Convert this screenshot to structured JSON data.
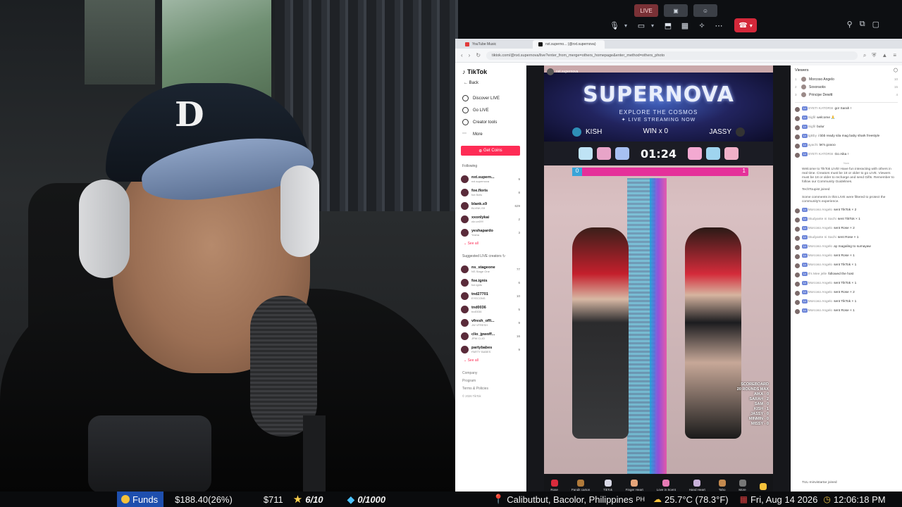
{
  "meeting": {
    "avatars": [
      "LIVE",
      "",
      ""
    ],
    "hangup_icon": "phone-hangup-icon"
  },
  "browser": {
    "tabs": [
      {
        "label": "YouTube Music",
        "icon": "youtube-music-icon"
      },
      {
        "label": "nxt.superno... (@nxt.supernova)",
        "icon": "tiktok-icon"
      }
    ],
    "url": "tiktok.com/@nxt.supernova/live?enter_from_merge=others_homepage&enter_method=others_photo"
  },
  "sidebar": {
    "logo": "TikTok",
    "back": "Back",
    "nav": [
      {
        "label": "Discover LIVE",
        "icon": "discover-icon"
      },
      {
        "label": "Go LIVE",
        "icon": "golive-icon"
      },
      {
        "label": "Creator tools",
        "icon": "tools-icon"
      },
      {
        "label": "More",
        "icon": "more-icon"
      }
    ],
    "get_coins": "Get Coins",
    "following_title": "Following",
    "following": [
      {
        "name": "nxt.supern...",
        "sub": "nxt.supernova",
        "count": "9"
      },
      {
        "name": "foe.floris",
        "sub": "foe.floris",
        "count": "8"
      },
      {
        "name": "blank.s9",
        "sub": "BLVNK-S9",
        "count": "629"
      },
      {
        "name": "xxonlykai",
        "sub": "ctz.un0!!!!",
        "count": "2"
      },
      {
        "name": "yeshapardo",
        "sub": "Yosha",
        "count": "3"
      }
    ],
    "see_all": "See all",
    "suggested_title": "Suggested LIVE creators",
    "suggested": [
      {
        "name": "ns_stageone",
        "sub": "NS Stage One",
        "count": "77"
      },
      {
        "name": "foe.ignis",
        "sub": "foe.ignis",
        "count": "6"
      },
      {
        "name": "tnd27701",
        "sub": "EYECONS",
        "count": "10"
      },
      {
        "name": "tnd0036",
        "sub": "tnd0036",
        "count": "5"
      },
      {
        "name": "vfresh_offi...",
        "sub": "JW VFRESH",
        "count": "9"
      },
      {
        "name": "clio_jpwoff...",
        "sub": "JPW CLIO",
        "count": "16"
      },
      {
        "name": "partybabes",
        "sub": "PARTY BABES",
        "count": "9"
      }
    ],
    "see_all_2": "See all",
    "footer": [
      "Company",
      "Program",
      "Terms & Policies"
    ],
    "copyright": "© 2026 TikTok"
  },
  "stream": {
    "streamer": "nxt.supernova",
    "banner_title": "SUPERNOVA",
    "banner_sub": "EXPLORE THE COSMOS",
    "banner_sub2": "LIVE STREAMING NOW",
    "left_player": "KISH",
    "mid_label": "WIN x 0",
    "right_player": "JASSY",
    "timer": "01:24",
    "score_left": "0",
    "score_right": "1",
    "scoreboard": [
      "SCOREBOARD",
      "20 ROUNDS MAX",
      "AIKA - 0",
      "SARAH - 2",
      "SAM - 0",
      "KISH - 1",
      "JASSY - 0",
      "MINMIN - 0",
      "MISSY - 0"
    ],
    "gifts": [
      {
        "name": "Rose",
        "color": "#d92b3c"
      },
      {
        "name": "Pandit carton",
        "color": "#b07a3a"
      },
      {
        "name": "TikTok",
        "color": "#d9d9e6"
      },
      {
        "name": "Finger Heart",
        "color": "#e5a57a"
      },
      {
        "name": "Love in Scent",
        "color": "#e67ab4"
      },
      {
        "name": "Hand Heart",
        "color": "#c8b1d9"
      },
      {
        "name": "Taho",
        "color": "#c48a4f"
      },
      {
        "name": "More",
        "color": "#777777"
      },
      {
        "name": "",
        "color": "#f5c13a"
      }
    ]
  },
  "chat": {
    "viewers_title": "Viewers",
    "top_viewers": [
      {
        "rank": "1",
        "name": "Morcoso Angelo",
        "count": "10"
      },
      {
        "rank": "2",
        "name": "Sosoraoks",
        "count": "15"
      },
      {
        "rank": "3",
        "name": "Principe Dewitt",
        "count": "4"
      }
    ],
    "messages": [
      {
        "name": "SYETI KATORSI",
        "text": "go! Sarah !"
      },
      {
        "name": "Sigfil",
        "text": "welcome 🙏"
      },
      {
        "name": "Sigfil",
        "text": "bulur"
      },
      {
        "name": "tgBby",
        "text": "i bbb ready sila mag baby shark freestyle"
      },
      {
        "name": "ayachi",
        "text": "let's goooo"
      },
      {
        "name": "SYETI KATORSI",
        "text": "Go Aika !"
      }
    ],
    "divider_label": "Now",
    "welcome": "Welcome to TikTok LIVE! Have fun interacting with others in real time. Creators must be 18 or older to go LIVE. Viewers must be 18 or older to recharge and send Gifts. Remember to follow our Community Guidelines.",
    "joined": "TechToupist joined",
    "filtered": "Some comments in this LIVE were filtered to protect the community's experience.",
    "events": [
      {
        "name": "Morcoso Angelo",
        "text": "sent TikTok × 2"
      },
      {
        "name": "Studyante ni Sachi",
        "text": "sent TikTok × 1"
      },
      {
        "name": "Morcoso Angelo",
        "text": "sent Rose × 2"
      },
      {
        "name": "Studyante ni Sachi",
        "text": "sent Rose × 1"
      },
      {
        "name": "Morcoso Angelo",
        "text": "ay magaling to sumayaw"
      },
      {
        "name": "Morcoso Angelo",
        "text": "sent Rose × 1"
      },
      {
        "name": "Morcoso Angelo",
        "text": "sent TikTok × 1"
      },
      {
        "name": "It's Mee jelle",
        "text": "followed the host"
      },
      {
        "name": "Morcoso Angelo",
        "text": "sent TikTok × 1"
      },
      {
        "name": "Morcoso Angelo",
        "text": "sent Rose × 2"
      },
      {
        "name": "Morcoso Angelo",
        "text": "sent TikTok × 1"
      },
      {
        "name": "Morcoso Angelo",
        "text": "sent Rose × 1"
      }
    ],
    "last": "TUL-minvistartar joined"
  },
  "ticker": {
    "funds_label": "Funds",
    "funds_value": "$188.40(26%)",
    "amount": "$711",
    "stars": "6/10",
    "gems": "0/1000",
    "location": "Calibutbut, Bacolor, Philippines",
    "country": "PH",
    "weather": "25.7°C (78.3°F)",
    "date": "Fri, Aug 14 2026",
    "time": "12:06:18 PM"
  },
  "colors": {
    "tiktok_pink": "#fe2c55",
    "funds_bg": "#1e4fae",
    "beam": "#8a3fe0"
  }
}
